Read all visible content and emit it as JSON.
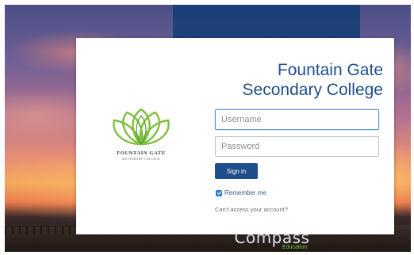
{
  "background": {
    "brand_word": "Compass",
    "brand_sub": "Education"
  },
  "login_card": {
    "school_name_line1": "Fountain Gate",
    "school_name_line2": "Secondary College",
    "logo": {
      "icon": "lotus-flower-icon",
      "name_line1": "FOUNTAIN GATE",
      "name_line2": "SECONDARY COLLEGE"
    },
    "username": {
      "placeholder": "Username",
      "value": ""
    },
    "password": {
      "placeholder": "Password",
      "value": ""
    },
    "sign_in_label": "Sign in",
    "remember_me": {
      "label": "Remember me",
      "checked": true
    },
    "cant_access_label": "Can't access your account?"
  },
  "colors": {
    "brand_blue": "#1f4e8c",
    "logo_green": "#7fbf3f",
    "checkbox_blue": "#2f7fd1"
  }
}
